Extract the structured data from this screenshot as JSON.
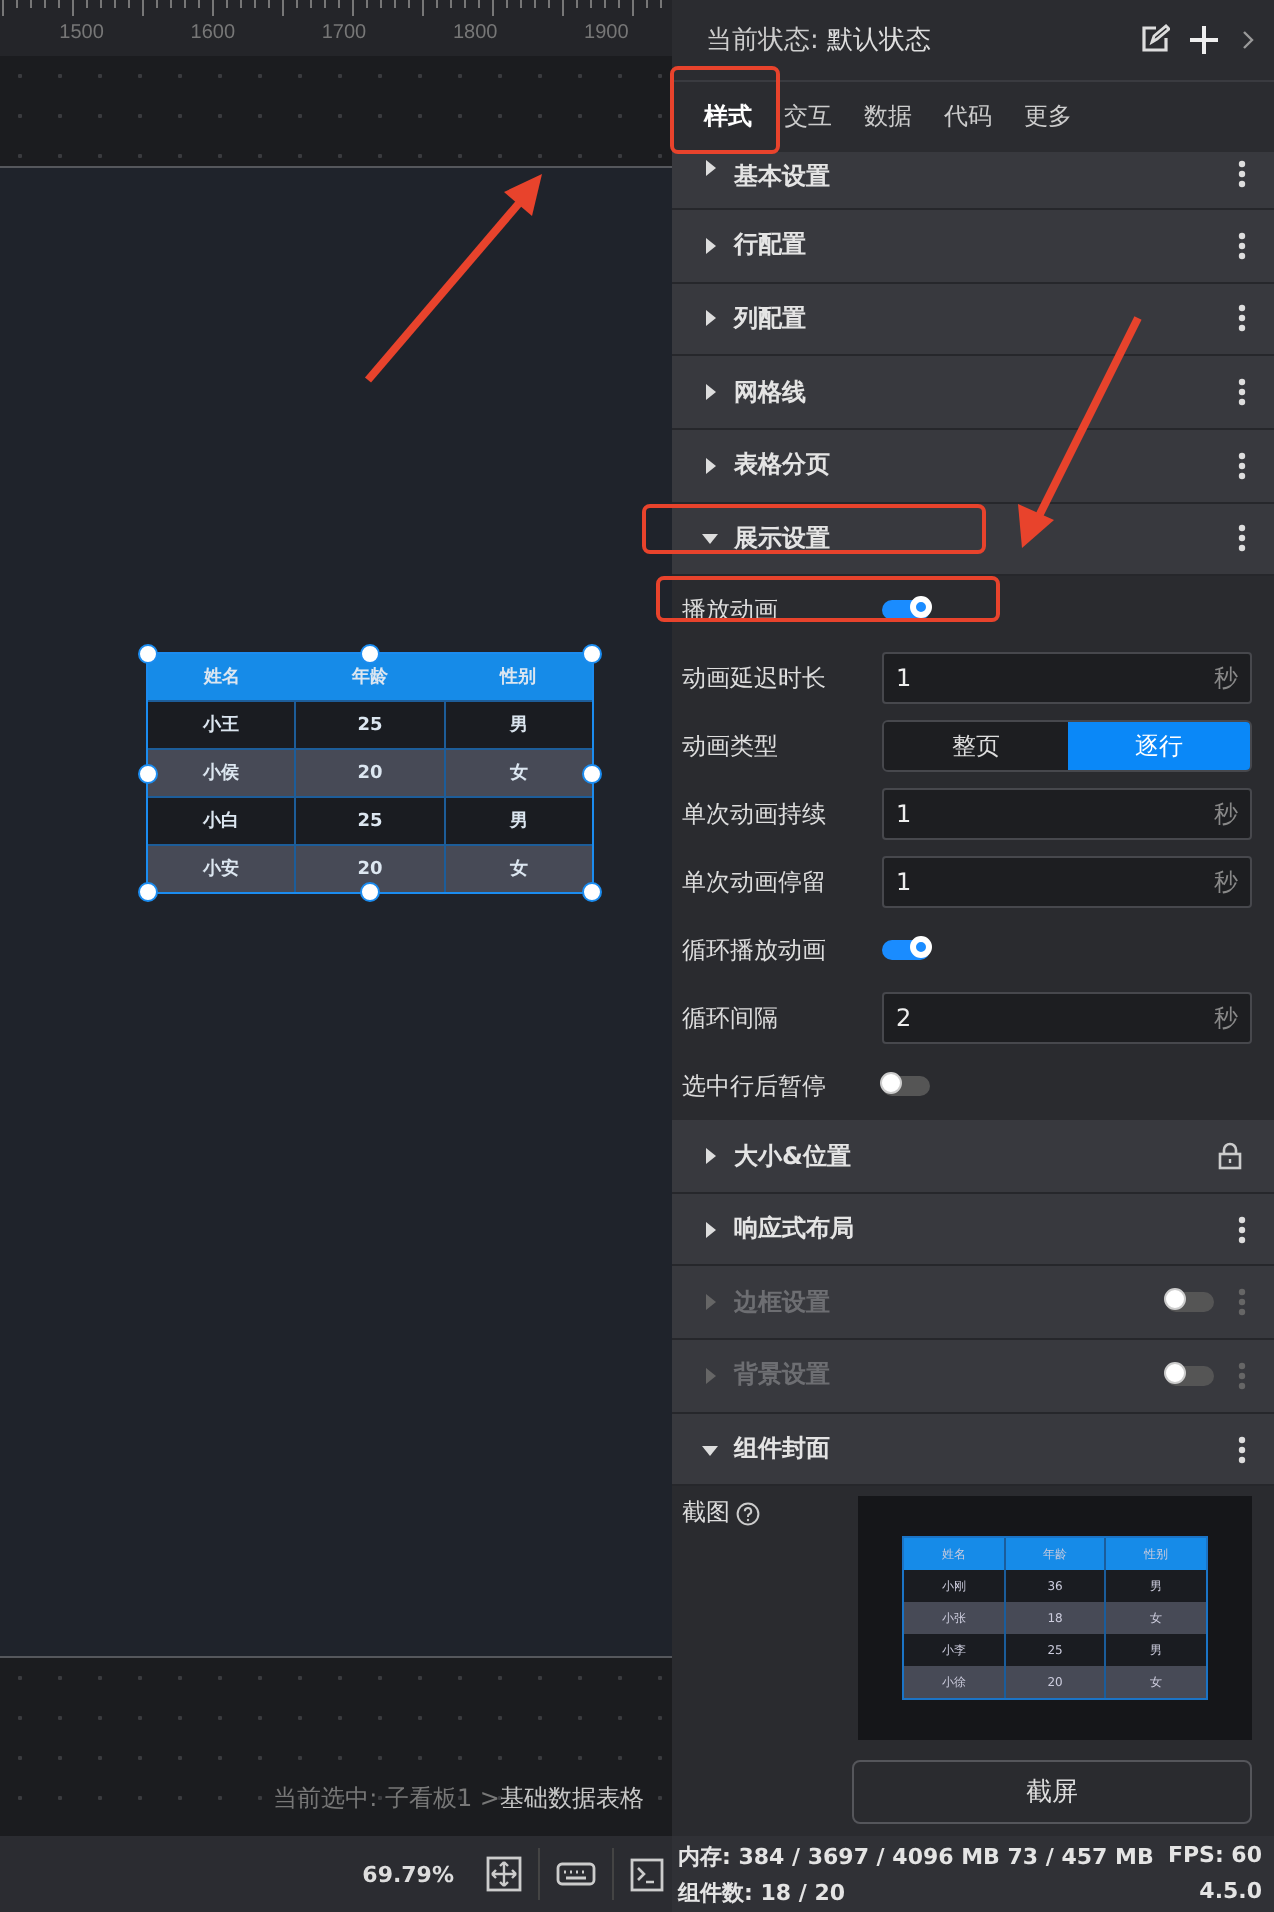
{
  "ruler": {
    "ticks": [
      "1500",
      "1600",
      "1700",
      "1800",
      "1900"
    ]
  },
  "canvas": {
    "table": {
      "columns": [
        "姓名",
        "年龄",
        "性别"
      ],
      "rows": [
        [
          "小王",
          "25",
          "男"
        ],
        [
          "小侯",
          "20",
          "女"
        ],
        [
          "小白",
          "25",
          "男"
        ],
        [
          "小安",
          "20",
          "女"
        ]
      ]
    },
    "breadcrumb": {
      "path": "当前选中: 子看板1 >",
      "current": "基础数据表格"
    }
  },
  "toolbar": {
    "zoom": "69.79%"
  },
  "panel": {
    "state_label": "当前状态:",
    "state_value": "默认状态",
    "tabs": [
      {
        "label": "样式",
        "selected": true
      },
      {
        "label": "交互",
        "selected": false
      },
      {
        "label": "数据",
        "selected": false
      },
      {
        "label": "代码",
        "selected": false
      },
      {
        "label": "更多",
        "selected": false
      }
    ],
    "sections": [
      {
        "title": "基本设置",
        "expanded": false,
        "disabled": false,
        "kind": "menu"
      },
      {
        "title": "行配置",
        "expanded": false,
        "disabled": false,
        "kind": "menu"
      },
      {
        "title": "列配置",
        "expanded": false,
        "disabled": false,
        "kind": "menu"
      },
      {
        "title": "网格线",
        "expanded": false,
        "disabled": false,
        "kind": "menu"
      },
      {
        "title": "表格分页",
        "expanded": false,
        "disabled": false,
        "kind": "menu"
      },
      {
        "title": "展示设置",
        "expanded": true,
        "disabled": false,
        "kind": "menu",
        "settings": [
          {
            "kind": "toggle",
            "label": "播放动画",
            "on": true
          },
          {
            "kind": "input",
            "label": "动画延迟时长",
            "value": "1",
            "unit": "秒"
          },
          {
            "kind": "segmented",
            "label": "动画类型",
            "options": [
              {
                "label": "整页",
                "selected": false
              },
              {
                "label": "逐行",
                "selected": true
              }
            ]
          },
          {
            "kind": "input",
            "label": "单次动画持续",
            "value": "1",
            "unit": "秒"
          },
          {
            "kind": "input",
            "label": "单次动画停留",
            "value": "1",
            "unit": "秒"
          },
          {
            "kind": "toggle",
            "label": "循环播放动画",
            "on": true
          },
          {
            "kind": "input",
            "label": "循环间隔",
            "value": "2",
            "unit": "秒"
          },
          {
            "kind": "toggle",
            "label": "选中行后暂停",
            "on": false
          }
        ]
      },
      {
        "title": "大小&位置",
        "expanded": false,
        "disabled": false,
        "kind": "lock"
      },
      {
        "title": "响应式布局",
        "expanded": false,
        "disabled": false,
        "kind": "menu"
      },
      {
        "title": "边框设置",
        "expanded": false,
        "disabled": true,
        "kind": "toggle",
        "on": false
      },
      {
        "title": "背景设置",
        "expanded": false,
        "disabled": true,
        "kind": "toggle",
        "on": false
      },
      {
        "title": "组件封面",
        "expanded": true,
        "disabled": false,
        "kind": "menu",
        "cover": {
          "label": "截图",
          "button": "截屏",
          "preview": {
            "columns": [
              "姓名",
              "年龄",
              "性别"
            ],
            "rows": [
              [
                "小刚",
                "36",
                "男"
              ],
              [
                "小张",
                "18",
                "女"
              ],
              [
                "小李",
                "25",
                "男"
              ],
              [
                "小徐",
                "20",
                "女"
              ]
            ]
          }
        }
      }
    ]
  },
  "status_bar": {
    "memory": "内存: 384 / 3697 / 4096 MB  73 / 457 MB",
    "fps": "FPS: 60",
    "components": "组件数: 18 / 20",
    "version": "4.5.0"
  }
}
